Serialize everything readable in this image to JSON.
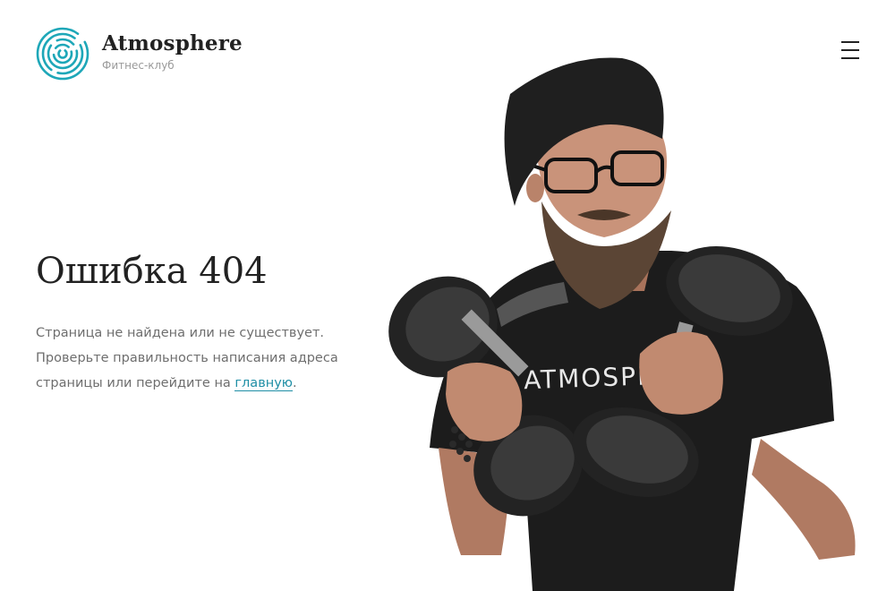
{
  "brand": {
    "name": "Atmosphere",
    "tagline": "Фитнес-клуб",
    "accent_color": "#1ea7b8"
  },
  "header": {
    "menu_icon": "hamburger-icon"
  },
  "error": {
    "title": "Ошибка 404",
    "line1": "Страница не найдена или не существует.",
    "line2": "Проверьте правильность написания адреса",
    "line3_before": "страницы или перейдите на ",
    "link_text": "главную",
    "line3_after": "."
  },
  "hero": {
    "shirt_text": "ATMOSPHE"
  }
}
